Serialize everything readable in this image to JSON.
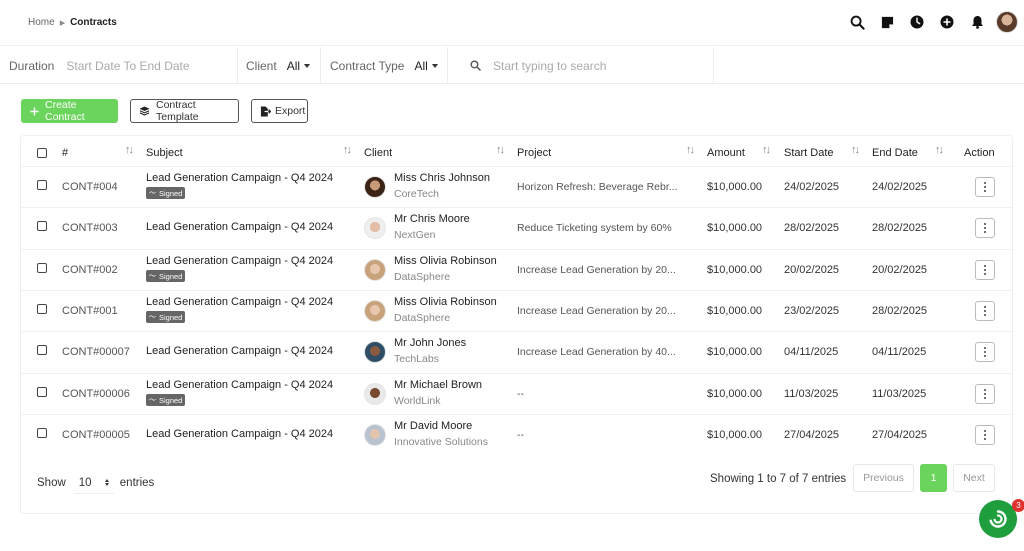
{
  "breadcrumb": {
    "home": "Home",
    "current": "Contracts"
  },
  "top_icons": [
    "search-icon",
    "sticky-note-icon",
    "clock-icon",
    "plus-circle-icon",
    "bell-icon",
    "user-avatar"
  ],
  "filters": {
    "duration_label": "Duration",
    "duration_placeholder": "Start Date To End Date",
    "client_label": "Client",
    "client_value": "All",
    "type_label": "Contract Type",
    "type_value": "All",
    "search_placeholder": "Start typing to search"
  },
  "toolbar": {
    "create_label": "Create Contract",
    "template_label": "Contract Template",
    "export_label": "Export"
  },
  "table": {
    "headers": [
      "#",
      "Subject",
      "Client",
      "Project",
      "Amount",
      "Start Date",
      "End Date",
      "Action"
    ],
    "rows": [
      {
        "id": "CONT#004",
        "subject": "Lead Generation Campaign - Q4 2024",
        "signed": true,
        "client": "Miss Chris Johnson",
        "company": "CoreTech",
        "project": "Horizon Refresh: Beverage Rebr...",
        "amount": "$10,000.00",
        "start": "24/02/2025",
        "end": "24/02/2025"
      },
      {
        "id": "CONT#003",
        "subject": "Lead Generation Campaign - Q4 2024",
        "signed": false,
        "client": "Mr Chris Moore",
        "company": "NextGen",
        "project": "Reduce Ticketing system by 60%",
        "amount": "$10,000.00",
        "start": "28/02/2025",
        "end": "28/02/2025"
      },
      {
        "id": "CONT#002",
        "subject": "Lead Generation Campaign - Q4 2024",
        "signed": true,
        "client": "Miss Olivia Robinson",
        "company": "DataSphere",
        "project": "Increase Lead Generation by 20...",
        "amount": "$10,000.00",
        "start": "20/02/2025",
        "end": "20/02/2025"
      },
      {
        "id": "CONT#001",
        "subject": "Lead Generation Campaign - Q4 2024",
        "signed": true,
        "client": "Miss Olivia Robinson",
        "company": "DataSphere",
        "project": "Increase Lead Generation by 20...",
        "amount": "$10,000.00",
        "start": "23/02/2025",
        "end": "28/02/2025"
      },
      {
        "id": "CONT#00007",
        "subject": "Lead Generation Campaign - Q4 2024",
        "signed": false,
        "client": "Mr John Jones",
        "company": "TechLabs",
        "project": "Increase Lead Generation by 40...",
        "amount": "$10,000.00",
        "start": "04/11/2025",
        "end": "04/11/2025"
      },
      {
        "id": "CONT#00006",
        "subject": "Lead Generation Campaign - Q4 2024",
        "signed": true,
        "client": "Mr Michael Brown",
        "company": "WorldLink",
        "project": "--",
        "amount": "$10,000.00",
        "start": "11/03/2025",
        "end": "11/03/2025"
      },
      {
        "id": "CONT#00005",
        "subject": "Lead Generation Campaign - Q4 2024",
        "signed": false,
        "client": "Mr David Moore",
        "company": "Innovative Solutions",
        "project": "--",
        "amount": "$10,000.00",
        "start": "27/04/2025",
        "end": "27/04/2025"
      }
    ],
    "signed_label": "Signed"
  },
  "footer": {
    "show_label": "Show",
    "page_length": "10",
    "entries_label": "entries",
    "showing_text": "Showing 1 to 7 of 7 entries",
    "previous": "Previous",
    "current_page": "1",
    "next": "Next"
  },
  "chat_fab": {
    "badge_count": "3"
  },
  "colors": {
    "accent": "#6bd45c",
    "fab": "#1e9e3d",
    "badge": "#e0322f",
    "signed_badge": "#666666"
  }
}
